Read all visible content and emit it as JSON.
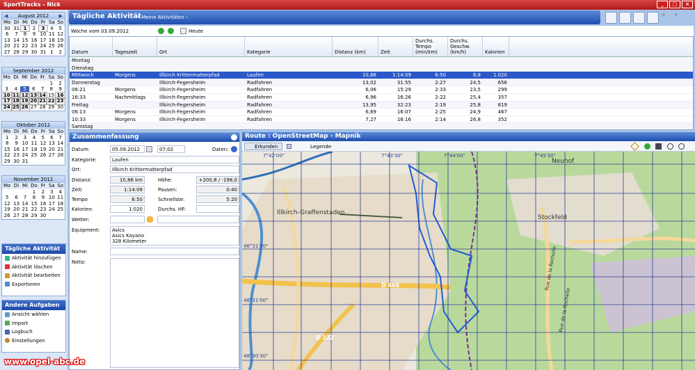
{
  "window": {
    "title": "SportTracks - Nick"
  },
  "calendars": [
    {
      "month": "August 2012",
      "weekdays": [
        "Mo",
        "Di",
        "Mi",
        "Do",
        "Fr",
        "Sa",
        "So"
      ],
      "rows": [
        [
          "30",
          "31",
          "1",
          "2",
          "3",
          "4",
          "5"
        ],
        [
          "6",
          "7",
          "8",
          "9",
          "10",
          "11",
          "12"
        ],
        [
          "13",
          "14",
          "15",
          "16",
          "17",
          "18",
          "19"
        ],
        [
          "20",
          "21",
          "22",
          "23",
          "24",
          "25",
          "26"
        ],
        [
          "27",
          "28",
          "29",
          "30",
          "31",
          "1",
          "2"
        ]
      ]
    },
    {
      "month": "September 2012",
      "weekdays": [
        "Mo",
        "Di",
        "Mi",
        "Do",
        "Fr",
        "Sa",
        "So"
      ],
      "rows": [
        [
          "",
          "",
          "",
          "",
          "",
          "1",
          "2"
        ],
        [
          "3",
          "4",
          "5",
          "6",
          "7",
          "8",
          "9"
        ],
        [
          "10",
          "11",
          "12",
          "13",
          "14",
          "15",
          "16"
        ],
        [
          "17",
          "18",
          "19",
          "20",
          "21",
          "22",
          "23"
        ],
        [
          "24",
          "25",
          "26",
          "27",
          "28",
          "29",
          "30"
        ]
      ]
    },
    {
      "month": "Oktober 2012",
      "weekdays": [
        "Mo",
        "Di",
        "Mi",
        "Do",
        "Fr",
        "Sa",
        "So"
      ],
      "rows": [
        [
          "1",
          "2",
          "3",
          "4",
          "5",
          "6",
          "7"
        ],
        [
          "8",
          "9",
          "10",
          "11",
          "12",
          "13",
          "14"
        ],
        [
          "15",
          "16",
          "17",
          "18",
          "19",
          "20",
          "21"
        ],
        [
          "22",
          "23",
          "24",
          "25",
          "26",
          "27",
          "28"
        ],
        [
          "29",
          "30",
          "31",
          "",
          "",
          "",
          ""
        ]
      ]
    },
    {
      "month": "November 2012",
      "weekdays": [
        "Mo",
        "Di",
        "Mi",
        "Do",
        "Fr",
        "Sa",
        "So"
      ],
      "rows": [
        [
          "",
          "",
          "",
          "1",
          "2",
          "3",
          "4"
        ],
        [
          "5",
          "6",
          "7",
          "8",
          "9",
          "10",
          "11"
        ],
        [
          "12",
          "13",
          "14",
          "15",
          "16",
          "17",
          "18"
        ],
        [
          "19",
          "20",
          "21",
          "22",
          "23",
          "24",
          "25"
        ],
        [
          "26",
          "27",
          "28",
          "29",
          "30",
          "",
          ""
        ]
      ]
    }
  ],
  "tasks_daily": {
    "title": "Tägliche Aktivität",
    "items": [
      "Aktivität hinzufügen",
      "Aktivität löschen",
      "Aktivität bearbeiten",
      "Exportieren"
    ]
  },
  "tasks_other": {
    "title": "Andere Aufgaben",
    "items": [
      "Ansicht wählen",
      "Import",
      "Logbuch",
      "Einstellungen"
    ]
  },
  "header": {
    "title": "Tägliche Aktivität",
    "breadcrumb": "• Meine Aktivitäten ›"
  },
  "weekbar": {
    "label": "Woche vom 03.09.2012",
    "today": "Heute"
  },
  "table": {
    "columns": [
      "Datum",
      "Tageszeit",
      "Ort",
      "Kategorie",
      "Distanz (km)",
      "Zeit",
      "Durchs. Tempo (min/km)",
      "Durchs. Geschw. (km/h)",
      "Kalorien"
    ],
    "rows": [
      {
        "type": "grp",
        "c": [
          "Montag",
          "",
          "",
          "",
          "",
          "",
          "",
          "",
          ""
        ]
      },
      {
        "type": "grp",
        "c": [
          "Dienstag",
          "",
          "",
          "",
          "",
          "",
          "",
          "",
          ""
        ]
      },
      {
        "type": "sel",
        "c": [
          "Mittwoch",
          "Morgens",
          "Illkirch Krittermatterpfad",
          "Laufen",
          "10,86",
          "1:14:09",
          "6:50",
          "8,8",
          "1.020"
        ]
      },
      {
        "type": "grp",
        "c": [
          "Donnerstag",
          "",
          "Illkirch-Fegersheim",
          "Radfahren",
          "13,02",
          "31:55",
          "2:27",
          "24,5",
          "656"
        ]
      },
      {
        "type": "",
        "c": [
          "06:21",
          "Morgens",
          "Illkirch-Fegersheim",
          "Radfahren",
          "6,06",
          "15:29",
          "2:33",
          "23,5",
          "299"
        ]
      },
      {
        "type": "",
        "c": [
          "16:33",
          "Nachmittags",
          "Illkirch-Fegersheim",
          "Radfahren",
          "6,96",
          "16:26",
          "2:22",
          "25,4",
          "357"
        ]
      },
      {
        "type": "grp",
        "c": [
          "Freitag",
          "",
          "Illkirch-Fegersheim",
          "Radfahren",
          "13,95",
          "32:23",
          "2:19",
          "25,8",
          "819"
        ]
      },
      {
        "type": "",
        "c": [
          "06:13",
          "Morgens",
          "Illkirch-Fegersheim",
          "Radfahren",
          "6,69",
          "16:07",
          "2:25",
          "24,9",
          "467"
        ]
      },
      {
        "type": "",
        "c": [
          "10:33",
          "Morgens",
          "Illkirch-Fegersheim",
          "Radfahren",
          "7,27",
          "16:16",
          "2:14",
          "26,8",
          "352"
        ]
      },
      {
        "type": "grp",
        "c": [
          "Samstag",
          "",
          "",
          "",
          "",
          "",
          "",
          "",
          ""
        ]
      }
    ]
  },
  "summary": {
    "title": "Zusammenfassung",
    "datum_label": "Datum:",
    "datum": "05.09.2012",
    "time": "07:02",
    "daten_label": "Daten:",
    "kategorie_label": "Kategorie:",
    "kategorie": "Laufen",
    "ort_label": "Ort:",
    "ort": "Illkirch Krittermatterpfad",
    "distanz_label": "Distanz:",
    "distanz": "10,86 km",
    "hoehe_label": "Höhe:",
    "hoehe": "+200,8 / -198,0",
    "zeit_label": "Zeit:",
    "zeit": "1:14:09",
    "pausen_label": "Pausen:",
    "pausen": "0:40",
    "tempo_label": "Tempo",
    "tempo": "6:50",
    "schnellste_label": "Schnellste:",
    "schnellste": "5:20",
    "kalorien_label": "Kalorien:",
    "kalorien": "1.020",
    "hf_label": "Durchs. HF:",
    "wetter_label": "Wetter:",
    "equipment_label": "Equipment:",
    "equipment": [
      "Asics",
      "Asics Kayano",
      "328 Kilometer"
    ],
    "name_label": "Name:",
    "notiz_label": "Notiz:"
  },
  "map": {
    "title": "Route : OpenStreetMap - Mapnik",
    "explore": "Erkunden",
    "legend": "Legende",
    "places": [
      "Illkirch-Graffenstaden",
      "Stockfeld",
      "Neuhof"
    ],
    "roads": [
      "D 468",
      "D 222",
      "Rue de la Rochelle",
      "Rue de la Rochelle"
    ],
    "grid_labels": [
      "7°42'00\"",
      "7°43'30\"",
      "7°44'00\"",
      "7°45'30\"",
      "48°31'30\"",
      "48°31'00\"",
      "48°30'30\""
    ]
  },
  "footer": {
    "watermark": "www.opel-abc.de"
  }
}
